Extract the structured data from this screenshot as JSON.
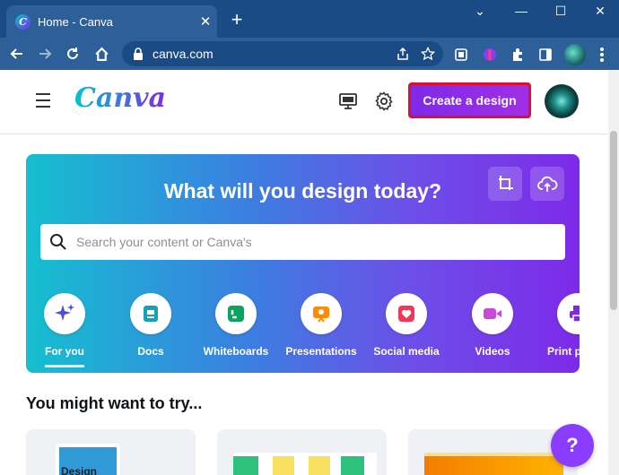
{
  "browser": {
    "tab_title": "Home - Canva",
    "tab_close": "✕",
    "new_tab": "+",
    "url": "canva.com",
    "window_controls": [
      "⌄",
      "—",
      "☐",
      "✕"
    ]
  },
  "header": {
    "logo": "Canva",
    "create_button": "Create a design"
  },
  "hero": {
    "title": "What will you design today?",
    "search_placeholder": "Search your content or Canva's",
    "categories": [
      {
        "label": "For you",
        "icon": "sparkle-icon",
        "color": "#4a4ed8"
      },
      {
        "label": "Docs",
        "icon": "docs-icon",
        "color": "#13a3b5"
      },
      {
        "label": "Whiteboards",
        "icon": "whiteboard-icon",
        "color": "#0ba360"
      },
      {
        "label": "Presentations",
        "icon": "presentation-icon",
        "color": "#ff8a00"
      },
      {
        "label": "Social media",
        "icon": "heart-icon",
        "color": "#f5365c"
      },
      {
        "label": "Videos",
        "icon": "video-icon",
        "color": "#c84bd8"
      },
      {
        "label": "Print pr",
        "icon": "print-icon",
        "color": "#7d2ae8"
      }
    ]
  },
  "suggestions": {
    "title": "You might want to try...",
    "card1_label": "Design"
  },
  "help": {
    "label": "?"
  },
  "colors": {
    "brand_purple": "#7d2ae8",
    "brand_teal": "#00c4cc",
    "highlight_red": "#e0102a"
  }
}
